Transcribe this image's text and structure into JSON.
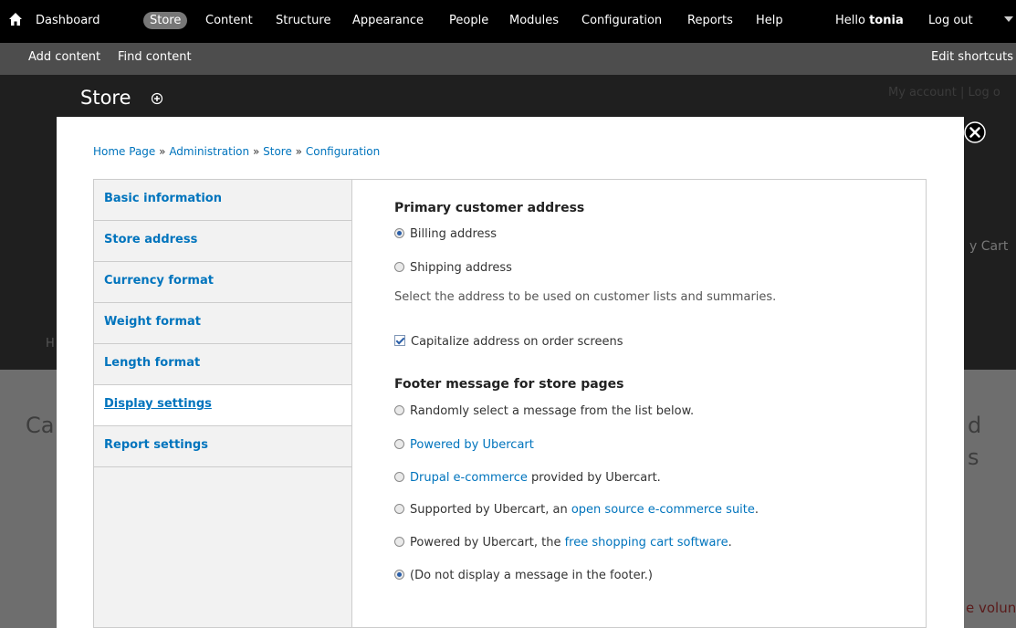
{
  "toolbar": {
    "menu": [
      "Dashboard",
      "Store",
      "Content",
      "Structure",
      "Appearance",
      "People",
      "Modules",
      "Configuration",
      "Reports",
      "Help"
    ],
    "active_menu": "Store",
    "hello_prefix": "Hello",
    "username": "tonia",
    "logout": "Log out"
  },
  "shortcuts": {
    "add_content": "Add content",
    "find_content": "Find content",
    "edit_shortcuts": "Edit shortcuts"
  },
  "background": {
    "title": "Store",
    "account_links": "My account  |  Log o",
    "cart_fragment": "y Cart",
    "left_fragment": "Ca",
    "right_fragment1": "d",
    "right_fragment2": "s",
    "bottom_fragment": "e volun",
    "h_fragment": "H"
  },
  "breadcrumb": {
    "items": [
      "Home Page",
      "Administration",
      "Store",
      "Configuration"
    ],
    "separator": "»"
  },
  "vertical_tabs": [
    {
      "label": "Basic information",
      "selected": false
    },
    {
      "label": "Store address",
      "selected": false
    },
    {
      "label": "Currency format",
      "selected": false
    },
    {
      "label": "Weight format",
      "selected": false
    },
    {
      "label": "Length format",
      "selected": false
    },
    {
      "label": "Display settings",
      "selected": true
    },
    {
      "label": "Report settings",
      "selected": false
    }
  ],
  "display_settings": {
    "address_heading": "Primary customer address",
    "address_options": [
      {
        "label": "Billing address",
        "checked": true
      },
      {
        "label": "Shipping address",
        "checked": false
      }
    ],
    "address_description": "Select the address to be used on customer lists and summaries.",
    "capitalize_label": "Capitalize address on order screens",
    "capitalize_checked": true,
    "footer_heading": "Footer message for store pages",
    "footer_options": {
      "random": "Randomly select a message from the list below.",
      "powered_link": "Powered by Ubercart",
      "drupal_link": "Drupal e-commerce",
      "drupal_rest": " provided by Ubercart.",
      "supported_prefix": "Supported by Ubercart, an ",
      "supported_link": "open source e-commerce suite",
      "supported_suffix": ".",
      "free_prefix": "Powered by Ubercart, the ",
      "free_link": "free shopping cart software",
      "free_suffix": ".",
      "none": "(Do not display a message in the footer.)"
    },
    "footer_selected": "none"
  },
  "colors": {
    "toolbar_bg": "#000000",
    "shortcuts_bg": "#4d4d4d",
    "link": "#0074bd",
    "active_pill": "#777777"
  }
}
